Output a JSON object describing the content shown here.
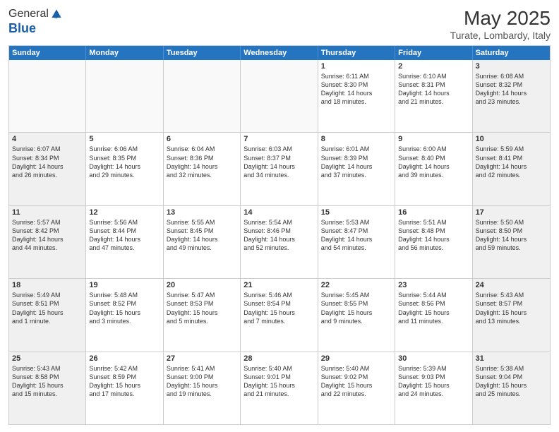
{
  "header": {
    "logo_general": "General",
    "logo_blue": "Blue",
    "month": "May 2025",
    "location": "Turate, Lombardy, Italy"
  },
  "weekdays": [
    "Sunday",
    "Monday",
    "Tuesday",
    "Wednesday",
    "Thursday",
    "Friday",
    "Saturday"
  ],
  "rows": [
    [
      {
        "day": "",
        "text": "",
        "empty": true
      },
      {
        "day": "",
        "text": "",
        "empty": true
      },
      {
        "day": "",
        "text": "",
        "empty": true
      },
      {
        "day": "",
        "text": "",
        "empty": true
      },
      {
        "day": "1",
        "text": "Sunrise: 6:11 AM\nSunset: 8:30 PM\nDaylight: 14 hours\nand 18 minutes.",
        "shaded": false
      },
      {
        "day": "2",
        "text": "Sunrise: 6:10 AM\nSunset: 8:31 PM\nDaylight: 14 hours\nand 21 minutes.",
        "shaded": false
      },
      {
        "day": "3",
        "text": "Sunrise: 6:08 AM\nSunset: 8:32 PM\nDaylight: 14 hours\nand 23 minutes.",
        "shaded": true
      }
    ],
    [
      {
        "day": "4",
        "text": "Sunrise: 6:07 AM\nSunset: 8:34 PM\nDaylight: 14 hours\nand 26 minutes.",
        "shaded": true
      },
      {
        "day": "5",
        "text": "Sunrise: 6:06 AM\nSunset: 8:35 PM\nDaylight: 14 hours\nand 29 minutes.",
        "shaded": false
      },
      {
        "day": "6",
        "text": "Sunrise: 6:04 AM\nSunset: 8:36 PM\nDaylight: 14 hours\nand 32 minutes.",
        "shaded": false
      },
      {
        "day": "7",
        "text": "Sunrise: 6:03 AM\nSunset: 8:37 PM\nDaylight: 14 hours\nand 34 minutes.",
        "shaded": false
      },
      {
        "day": "8",
        "text": "Sunrise: 6:01 AM\nSunset: 8:39 PM\nDaylight: 14 hours\nand 37 minutes.",
        "shaded": false
      },
      {
        "day": "9",
        "text": "Sunrise: 6:00 AM\nSunset: 8:40 PM\nDaylight: 14 hours\nand 39 minutes.",
        "shaded": false
      },
      {
        "day": "10",
        "text": "Sunrise: 5:59 AM\nSunset: 8:41 PM\nDaylight: 14 hours\nand 42 minutes.",
        "shaded": true
      }
    ],
    [
      {
        "day": "11",
        "text": "Sunrise: 5:57 AM\nSunset: 8:42 PM\nDaylight: 14 hours\nand 44 minutes.",
        "shaded": true
      },
      {
        "day": "12",
        "text": "Sunrise: 5:56 AM\nSunset: 8:44 PM\nDaylight: 14 hours\nand 47 minutes.",
        "shaded": false
      },
      {
        "day": "13",
        "text": "Sunrise: 5:55 AM\nSunset: 8:45 PM\nDaylight: 14 hours\nand 49 minutes.",
        "shaded": false
      },
      {
        "day": "14",
        "text": "Sunrise: 5:54 AM\nSunset: 8:46 PM\nDaylight: 14 hours\nand 52 minutes.",
        "shaded": false
      },
      {
        "day": "15",
        "text": "Sunrise: 5:53 AM\nSunset: 8:47 PM\nDaylight: 14 hours\nand 54 minutes.",
        "shaded": false
      },
      {
        "day": "16",
        "text": "Sunrise: 5:51 AM\nSunset: 8:48 PM\nDaylight: 14 hours\nand 56 minutes.",
        "shaded": false
      },
      {
        "day": "17",
        "text": "Sunrise: 5:50 AM\nSunset: 8:50 PM\nDaylight: 14 hours\nand 59 minutes.",
        "shaded": true
      }
    ],
    [
      {
        "day": "18",
        "text": "Sunrise: 5:49 AM\nSunset: 8:51 PM\nDaylight: 15 hours\nand 1 minute.",
        "shaded": true
      },
      {
        "day": "19",
        "text": "Sunrise: 5:48 AM\nSunset: 8:52 PM\nDaylight: 15 hours\nand 3 minutes.",
        "shaded": false
      },
      {
        "day": "20",
        "text": "Sunrise: 5:47 AM\nSunset: 8:53 PM\nDaylight: 15 hours\nand 5 minutes.",
        "shaded": false
      },
      {
        "day": "21",
        "text": "Sunrise: 5:46 AM\nSunset: 8:54 PM\nDaylight: 15 hours\nand 7 minutes.",
        "shaded": false
      },
      {
        "day": "22",
        "text": "Sunrise: 5:45 AM\nSunset: 8:55 PM\nDaylight: 15 hours\nand 9 minutes.",
        "shaded": false
      },
      {
        "day": "23",
        "text": "Sunrise: 5:44 AM\nSunset: 8:56 PM\nDaylight: 15 hours\nand 11 minutes.",
        "shaded": false
      },
      {
        "day": "24",
        "text": "Sunrise: 5:43 AM\nSunset: 8:57 PM\nDaylight: 15 hours\nand 13 minutes.",
        "shaded": true
      }
    ],
    [
      {
        "day": "25",
        "text": "Sunrise: 5:43 AM\nSunset: 8:58 PM\nDaylight: 15 hours\nand 15 minutes.",
        "shaded": true
      },
      {
        "day": "26",
        "text": "Sunrise: 5:42 AM\nSunset: 8:59 PM\nDaylight: 15 hours\nand 17 minutes.",
        "shaded": false
      },
      {
        "day": "27",
        "text": "Sunrise: 5:41 AM\nSunset: 9:00 PM\nDaylight: 15 hours\nand 19 minutes.",
        "shaded": false
      },
      {
        "day": "28",
        "text": "Sunrise: 5:40 AM\nSunset: 9:01 PM\nDaylight: 15 hours\nand 21 minutes.",
        "shaded": false
      },
      {
        "day": "29",
        "text": "Sunrise: 5:40 AM\nSunset: 9:02 PM\nDaylight: 15 hours\nand 22 minutes.",
        "shaded": false
      },
      {
        "day": "30",
        "text": "Sunrise: 5:39 AM\nSunset: 9:03 PM\nDaylight: 15 hours\nand 24 minutes.",
        "shaded": false
      },
      {
        "day": "31",
        "text": "Sunrise: 5:38 AM\nSunset: 9:04 PM\nDaylight: 15 hours\nand 25 minutes.",
        "shaded": true
      }
    ]
  ]
}
